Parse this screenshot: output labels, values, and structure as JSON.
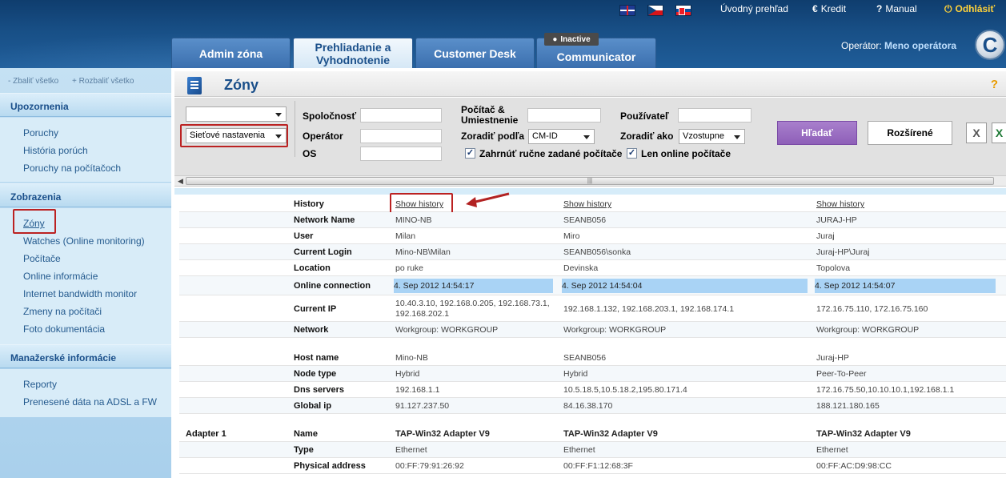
{
  "header": {
    "languages": [
      "English",
      "Čeština",
      "Slovenčina"
    ],
    "links": {
      "overview": "Úvodný prehľad",
      "credit": "Kredit",
      "manual": "Manual",
      "logout": "Odhlásiť"
    },
    "tabs": [
      {
        "label": "Admin zóna",
        "active": false
      },
      {
        "label": "Prehliadanie a Vyhodnotenie",
        "active": true
      },
      {
        "label": "Customer Desk",
        "active": false
      },
      {
        "label": "Communicator",
        "active": false
      }
    ],
    "inactive_badge": "Inactive",
    "operator_label": "Operátor:",
    "operator_name": "Meno operátora",
    "logo_letter": "C"
  },
  "sidebar": {
    "collapse_all": "Zbaliť všetko",
    "expand_all": "Rozbaliť všetko",
    "sections": [
      {
        "title": "Upozornenia",
        "items": [
          "Poruchy",
          "História porúch",
          "Poruchy na počítačoch"
        ]
      },
      {
        "title": "Zobrazenia",
        "items": [
          "Zóny",
          "Watches (Online monitoring)",
          "Počítače",
          "Online informácie",
          "Internet bandwidth monitor",
          "Zmeny na počítači",
          "Foto dokumentácia"
        ]
      },
      {
        "title": "Manažerské informácie",
        "items": [
          "Reporty",
          "Prenesené dáta na ADSL a FW"
        ]
      }
    ],
    "active_item": "Zóny"
  },
  "page": {
    "title": "Zóny",
    "help": "?"
  },
  "filter": {
    "select1_value": "",
    "select2_value": "Sieťové nastavenia",
    "company_label": "Spoločnosť",
    "operator_label": "Operátor",
    "os_label": "OS",
    "computer_label": "Počítač & Umiestnenie",
    "sort_by_label": "Zoradiť podľa",
    "sort_by_value": "CM-ID",
    "user_label": "Používateľ",
    "sort_as_label": "Zoradiť ako",
    "sort_as_value": "Vzostupne",
    "include_manual_label": "Zahrnúť ručne zadané počítače",
    "include_manual_checked": true,
    "online_only_label": "Len online počítače",
    "online_only_checked": true,
    "search_button": "Hľadať",
    "advanced_button": "Rozšírené"
  },
  "table": {
    "rows": [
      {
        "group": "",
        "label": "History",
        "values": [
          "Show history",
          "Show history",
          "Show history"
        ],
        "type": "link"
      },
      {
        "group": "",
        "label": "Network Name",
        "values": [
          "MINO-NB",
          "SEANB056",
          "JURAJ-HP"
        ]
      },
      {
        "group": "",
        "label": "User",
        "values": [
          "Milan",
          "Miro",
          "Juraj"
        ]
      },
      {
        "group": "",
        "label": "Current Login",
        "values": [
          "Mino-NB\\Milan",
          "SEANB056\\sonka",
          "Juraj-HP\\Juraj"
        ]
      },
      {
        "group": "",
        "label": "Location",
        "values": [
          "po ruke",
          "Devinska",
          "Topolova"
        ]
      },
      {
        "group": "",
        "label": "Online connection",
        "values": [
          "4. Sep 2012 14:54:17",
          "4. Sep 2012 14:54:04",
          "4. Sep 2012 14:54:07"
        ],
        "type": "highlight"
      },
      {
        "group": "",
        "label": "Current IP",
        "values": [
          "10.40.3.10, 192.168.0.205, 192.168.73.1, 192.168.202.1",
          "192.168.1.132, 192.168.203.1, 192.168.174.1",
          "172.16.75.110, 172.16.75.160"
        ]
      },
      {
        "group": "",
        "label": "Network",
        "values": [
          "Workgroup: WORKGROUP",
          "Workgroup: WORKGROUP",
          "Workgroup: WORKGROUP"
        ]
      },
      {
        "group": "",
        "label": "Host name",
        "values": [
          "Mino-NB",
          "SEANB056",
          "Juraj-HP"
        ]
      },
      {
        "group": "",
        "label": "Node type",
        "values": [
          "Hybrid",
          "Hybrid",
          "Peer-To-Peer"
        ]
      },
      {
        "group": "",
        "label": "Dns servers",
        "values": [
          "192.168.1.1",
          "10.5.18.5,10.5.18.2,195.80.171.4",
          "172.16.75.50,10.10.10.1,192.168.1.1"
        ]
      },
      {
        "group": "",
        "label": "Global ip",
        "values": [
          "91.127.237.50",
          "84.16.38.170",
          "188.121.180.165"
        ]
      },
      {
        "group": "Adapter 1",
        "label": "Name",
        "values": [
          "TAP-Win32 Adapter V9",
          "TAP-Win32 Adapter V9",
          "TAP-Win32 Adapter V9"
        ],
        "type": "bold"
      },
      {
        "group": "",
        "label": "Type",
        "values": [
          "Ethernet",
          "Ethernet",
          "Ethernet"
        ]
      },
      {
        "group": "",
        "label": "Physical address",
        "values": [
          "00:FF:79:91:26:92",
          "00:FF:F1:12:68:3F",
          "00:FF:AC:D9:98:CC"
        ]
      }
    ]
  },
  "colors": {
    "header": "#184f86",
    "sidebar": "#c5e1f3",
    "accent_button": "#9a6fc2",
    "online_highlight": "#a9d3f5",
    "callout": "#b22222"
  },
  "icons": [
    "flag-en-icon",
    "flag-cz-icon",
    "flag-sk-icon",
    "euro-icon",
    "help-icon",
    "power-icon",
    "user-icon",
    "zone-page-icon",
    "excel-export-icon",
    "excel-icon",
    "red-arrow-icon"
  ]
}
